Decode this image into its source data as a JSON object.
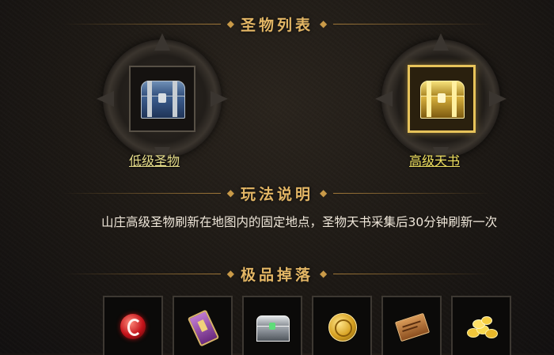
{
  "sections": {
    "holy_list_title": "圣物列表",
    "gameplay_title": "玩法说明",
    "drops_title": "极品掉落"
  },
  "items": [
    {
      "label": "低级圣物",
      "icon": "blue-treasure-chest-icon",
      "selected": false,
      "label_color": "#e6dd8a"
    },
    {
      "label": "高级天书",
      "icon": "gold-treasure-chest-icon",
      "selected": true,
      "label_color": "#efe060"
    }
  ],
  "gameplay": {
    "description": "山庄高级圣物刷新在地图内的固定地点，圣物天书采集后30分钟刷新一次"
  },
  "drops": [
    {
      "icon": "red-orb-icon"
    },
    {
      "icon": "purple-talisman-icon"
    },
    {
      "icon": "silver-chest-icon"
    },
    {
      "icon": "gold-coin-icon"
    },
    {
      "icon": "ancient-scroll-icon"
    },
    {
      "icon": "gold-pile-icon"
    }
  ],
  "colors": {
    "title_gold": "#e3b665",
    "selected_border": "#e7c35a",
    "text": "#efe7da"
  }
}
